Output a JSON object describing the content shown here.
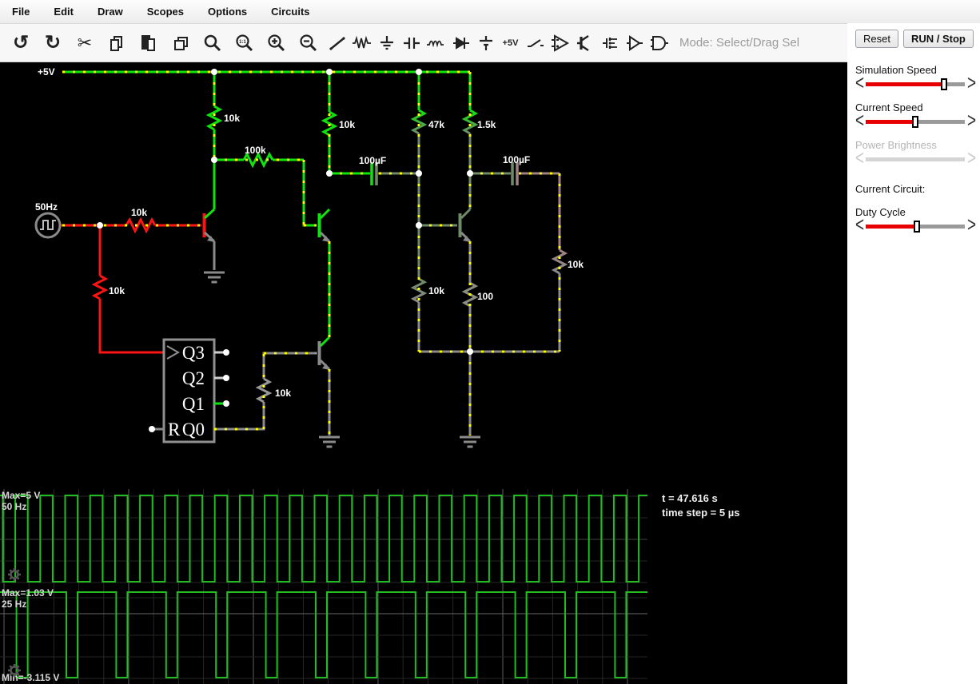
{
  "menu": {
    "items": [
      {
        "label": "File"
      },
      {
        "label": "Edit"
      },
      {
        "label": "Draw"
      },
      {
        "label": "Scopes"
      },
      {
        "label": "Options"
      },
      {
        "label": "Circuits"
      }
    ]
  },
  "toolbar": {
    "glyphs": {
      "undo": "↺",
      "redo": "↻",
      "cut": "✂",
      "plus5v": "+5V",
      "zoom100": "1:1"
    },
    "mode_label": "Mode: Select/Drag Sel"
  },
  "side_panel": {
    "reset_label": "Reset",
    "run_label": "RUN / Stop",
    "sliders": [
      {
        "label": "Simulation Speed",
        "value_pct": 79,
        "enabled": true
      },
      {
        "label": "Current Speed",
        "value_pct": 50,
        "enabled": true
      },
      {
        "label": "Power Brightness",
        "value_pct": 0,
        "enabled": false
      },
      {
        "label": "Duty Cycle",
        "value_pct": 52,
        "enabled": true
      }
    ],
    "current_circuit_label": "Current Circuit:"
  },
  "circuit": {
    "supply_label": "+5V",
    "source_label": "50Hz",
    "labels": {
      "r1": "10k",
      "r2": "10k",
      "r3": "47k",
      "r4": "1.5k",
      "r5": "100k",
      "cap1": "100µF",
      "cap2": "100µF",
      "r6": "10k",
      "r7": "10k",
      "r8": "10k",
      "r9": "100",
      "r10": "10k",
      "r11": "10k"
    },
    "chip": {
      "outputs": [
        "Q3",
        "Q2",
        "Q1",
        "Q0"
      ],
      "reset_label": "R"
    },
    "colors": {
      "wire_high": "#0fe40f",
      "wire_mid": "#6f8a68",
      "wire_zero": "#8a8a8a",
      "wire_neg": "#ff1414",
      "wire_low": "#a18282",
      "current_dot": "#ffff00",
      "junction": "#ffffff"
    }
  },
  "scopes": [
    {
      "max_label": "Max=5 V",
      "freq_label": "50 Hz"
    },
    {
      "max_label": "Max=1.03 V",
      "freq_label": "25 Hz",
      "min_label": "Min=-3.115 V"
    }
  ],
  "status": {
    "time_label": "t = 47.616 s",
    "step_label": "time step = 5 µs"
  },
  "chart_data": [
    {
      "type": "line",
      "waveform": "square",
      "frequency_hz": 50,
      "max_v": 5,
      "duty_pct": 50,
      "annotations": [
        "Max=5 V",
        "50 Hz"
      ],
      "color": "#22bb22"
    },
    {
      "type": "line",
      "waveform": "pulse",
      "frequency_hz": 25,
      "max_v": 1.03,
      "min_v": -3.115,
      "high_time_pct": 77,
      "annotations": [
        "Max=1.03 V",
        "25 Hz",
        "Min=-3.115 V"
      ],
      "color": "#22bb22"
    }
  ]
}
